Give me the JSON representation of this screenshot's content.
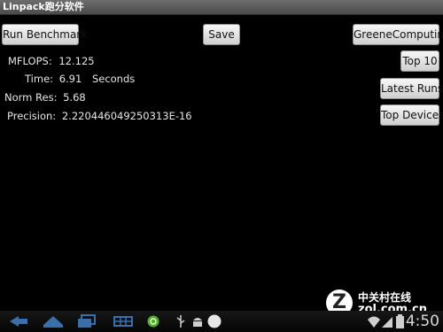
{
  "window": {
    "title": "Linpack跑分软件"
  },
  "toolbar": {
    "run_label": "Run Benchmark",
    "save_label": "Save",
    "greene_label": "GreeneComputing",
    "top10_label": "Top 10",
    "latest_label": "Latest Runs",
    "devices_label": "Top Devices"
  },
  "results": {
    "mflops_label": "MFLOPS:",
    "mflops_value": "12.125",
    "time_label": "Time:",
    "time_value": "6.91",
    "time_unit": "Seconds",
    "normres_label": "Norm Res:",
    "normres_value": "5.68",
    "precision_label": "Precision:",
    "precision_value": "2.220446049250313E-16"
  },
  "watermark": {
    "logo": "Z",
    "cn": "中关村在线",
    "url": "zol.com.cn"
  },
  "statusbar": {
    "clock": "4:50"
  },
  "icons": [
    "back-icon",
    "home-icon",
    "recent-apps-icon",
    "menu-grid-icon",
    "notification-app-icon",
    "usb-icon",
    "android-debug-icon",
    "sd-card-icon",
    "wifi-icon",
    "signal-icon",
    "battery-icon"
  ]
}
